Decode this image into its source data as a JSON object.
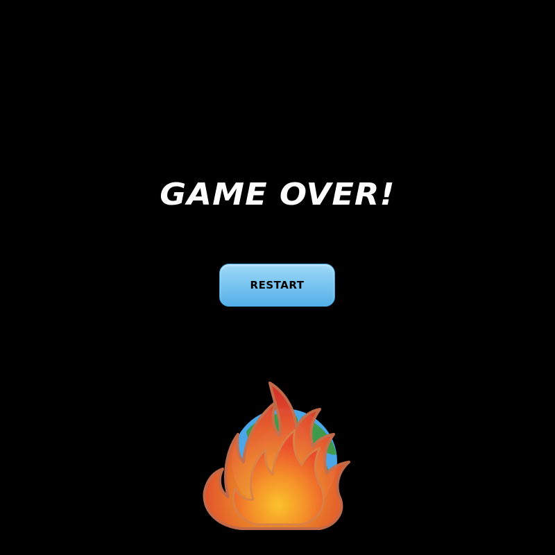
{
  "game": {
    "title": "GAME OVER!",
    "restart_label": "RESTART"
  },
  "icons": {
    "illustration": "burning-earth-icon"
  },
  "colors": {
    "background": "#000000",
    "title": "#ffffff",
    "button_top": "#9fd8f7",
    "button_bottom": "#53b0e8",
    "ocean": "#4aa6e6",
    "land": "#3f9a4b",
    "flame_outer": "#e8543a",
    "flame_core": "#f6b12a"
  }
}
